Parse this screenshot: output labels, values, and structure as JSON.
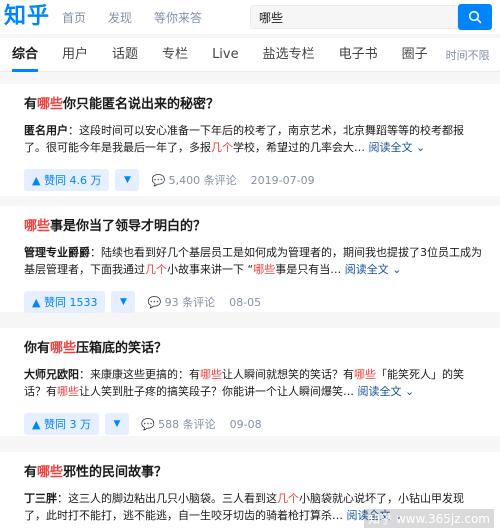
{
  "header": {
    "logo": "知乎",
    "nav": [
      "首页",
      "发现",
      "等你来答"
    ],
    "search_value": "哪些"
  },
  "tabs": {
    "items": [
      "综合",
      "用户",
      "话题",
      "专栏",
      "Live",
      "盐选专栏",
      "电子书",
      "圈子"
    ],
    "time_filter": "时间不限"
  },
  "cards": [
    {
      "title_pre": "有",
      "title_hl": "哪些",
      "title_post": "你只能匿名说出来的秘密？",
      "author": "匿名用户",
      "excerpt_a": "：这段时间可以安心准备一下年后的校考了，南京艺术，北京舞蹈等等的校考都报了。很可能今年是我最后一年了，多报",
      "excerpt_hl": "几个",
      "excerpt_b": "学校，希望过的几率会大…",
      "read_more": "阅读全文",
      "vote": "赞同 4.6 万",
      "comments": "5,400 条评论",
      "date": "2019-07-09"
    },
    {
      "title_pre": "",
      "title_hl": "哪些",
      "title_post": "事是你当了领导才明白的？",
      "author": "管理专业爵爵",
      "excerpt_a": "：陆续也看到好几个基层员工是如何成为管理者的，期间我也提拔了3位员工成为基层管理者，下面我通过",
      "excerpt_hl": "几个",
      "excerpt_b": "小故事来讲一下 “",
      "excerpt_hl2": "哪些",
      "excerpt_c": "事是只有当…",
      "read_more": "阅读全文",
      "vote": "赞同 1533",
      "comments": "93 条评论",
      "date": "08-05"
    },
    {
      "title_pre": "你有",
      "title_hl": "哪些",
      "title_post": "压箱底的笑话？",
      "author": "大师兄欧阳",
      "excerpt_a": "：来康康这些更搞的：有",
      "excerpt_hl": "哪些",
      "excerpt_b": "让人瞬间就想笑的笑话？有",
      "excerpt_hl2": "哪些",
      "excerpt_c": "「能笑死人」的笑话？有",
      "excerpt_hl3": "哪些",
      "excerpt_d": "让人笑到肚子疼的搞笑段子？你能讲一个让人瞬间爆笑…",
      "read_more": "阅读全文",
      "vote": "赞同 3 万",
      "comments": "588 条评论",
      "date": "09-08"
    },
    {
      "title_pre": "有",
      "title_hl": "哪些",
      "title_post": "邪性的民间故事？",
      "author": "丁三胖",
      "excerpt_a": "：这三人的脚边粘出几只小脑袋。三人看到这",
      "excerpt_hl": "几个",
      "excerpt_b": "小脑袋就心说坏了，小钻山甲发现了，此时打不能打，逃不能逃，自一生咬牙切齿的骑着枪打算杀…",
      "read_more": "阅读全文"
    }
  ],
  "watermark": "知乎 www.365jz.com",
  "colors": {
    "accent": "#0084ff",
    "highlight": "#f1403c",
    "link": "#175199"
  },
  "icons": {
    "search": "search-icon",
    "vote_up": "triangle-up-icon",
    "vote_down": "triangle-down-icon",
    "comment": "comment-bubble-icon",
    "chevron": "chevron-down-icon"
  }
}
